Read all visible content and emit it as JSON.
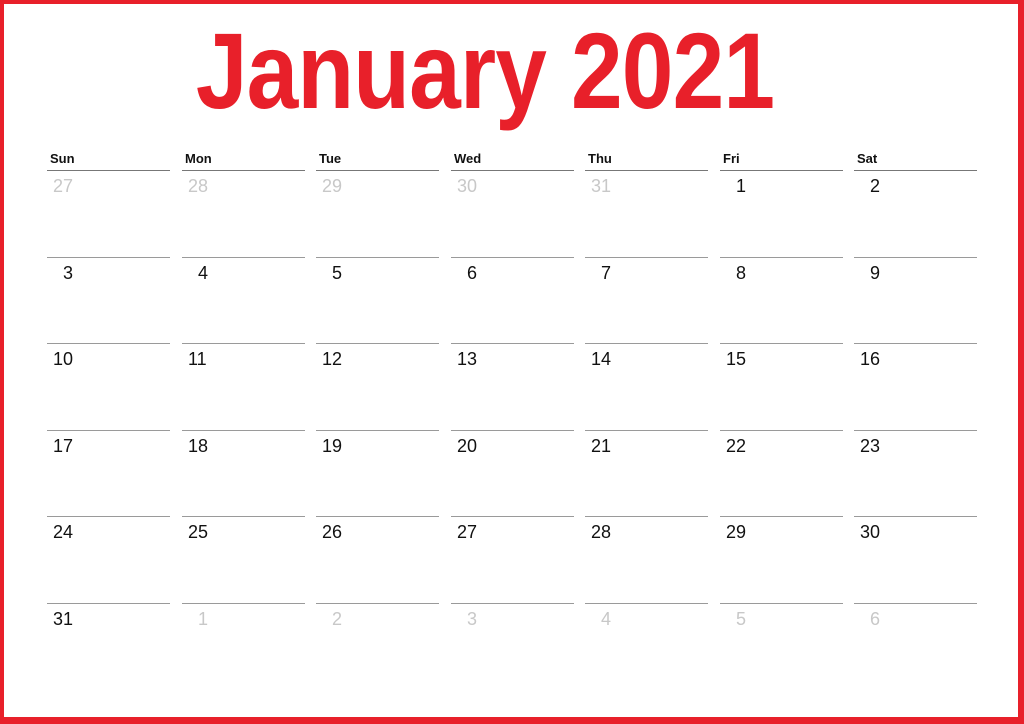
{
  "calendar": {
    "title": "January 2021",
    "accent_color": "#e8202a",
    "weekdays": [
      "Sun",
      "Mon",
      "Tue",
      "Wed",
      "Thu",
      "Fri",
      "Sat"
    ],
    "weeks": [
      [
        {
          "d": "27",
          "muted": true
        },
        {
          "d": "28",
          "muted": true
        },
        {
          "d": "29",
          "muted": true
        },
        {
          "d": "30",
          "muted": true
        },
        {
          "d": "31",
          "muted": true
        },
        {
          "d": "1",
          "muted": false
        },
        {
          "d": "2",
          "muted": false
        }
      ],
      [
        {
          "d": "3",
          "muted": false
        },
        {
          "d": "4",
          "muted": false
        },
        {
          "d": "5",
          "muted": false
        },
        {
          "d": "6",
          "muted": false
        },
        {
          "d": "7",
          "muted": false
        },
        {
          "d": "8",
          "muted": false
        },
        {
          "d": "9",
          "muted": false
        }
      ],
      [
        {
          "d": "10",
          "muted": false
        },
        {
          "d": "11",
          "muted": false
        },
        {
          "d": "12",
          "muted": false
        },
        {
          "d": "13",
          "muted": false
        },
        {
          "d": "14",
          "muted": false
        },
        {
          "d": "15",
          "muted": false
        },
        {
          "d": "16",
          "muted": false
        }
      ],
      [
        {
          "d": "17",
          "muted": false
        },
        {
          "d": "18",
          "muted": false
        },
        {
          "d": "19",
          "muted": false
        },
        {
          "d": "20",
          "muted": false
        },
        {
          "d": "21",
          "muted": false
        },
        {
          "d": "22",
          "muted": false
        },
        {
          "d": "23",
          "muted": false
        }
      ],
      [
        {
          "d": "24",
          "muted": false
        },
        {
          "d": "25",
          "muted": false
        },
        {
          "d": "26",
          "muted": false
        },
        {
          "d": "27",
          "muted": false
        },
        {
          "d": "28",
          "muted": false
        },
        {
          "d": "29",
          "muted": false
        },
        {
          "d": "30",
          "muted": false
        }
      ],
      [
        {
          "d": "31",
          "muted": false
        },
        {
          "d": "1",
          "muted": true
        },
        {
          "d": "2",
          "muted": true
        },
        {
          "d": "3",
          "muted": true
        },
        {
          "d": "4",
          "muted": true
        },
        {
          "d": "5",
          "muted": true
        },
        {
          "d": "6",
          "muted": true
        }
      ]
    ]
  }
}
